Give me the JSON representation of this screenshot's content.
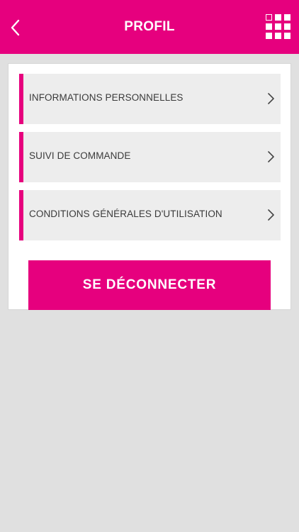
{
  "header": {
    "title": "PROFIL",
    "back_icon": "chevron-left-icon",
    "menu_icon": "grid-menu-icon"
  },
  "menu": {
    "items": [
      {
        "label": "INFORMATIONS PERSONNELLES",
        "icon": "chevron-right-icon"
      },
      {
        "label": "SUIVI DE COMMANDE",
        "icon": "chevron-right-icon"
      },
      {
        "label": "CONDITIONS GÉNÉRALES D'UTILISATION",
        "icon": "chevron-right-icon"
      }
    ]
  },
  "logout": {
    "label": "SE DÉCONNECTER"
  },
  "colors": {
    "accent": "#e6007e",
    "item_bg": "#ededed",
    "page_bg": "#e0e0e0",
    "text": "#3a3a3a"
  }
}
